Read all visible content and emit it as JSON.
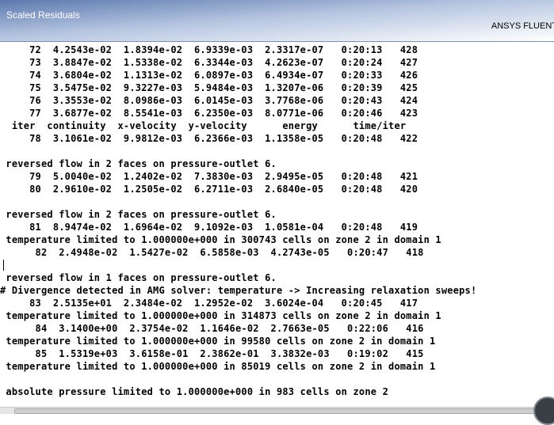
{
  "window": {
    "title": "Scaled Residuals",
    "brand": "ANSYS FLUENT"
  },
  "console": {
    "lines": [
      "     72  4.2543e-02  1.8394e-02  6.9339e-03  2.3317e-07   0:20:13   428",
      "     73  3.8847e-02  1.5338e-02  6.3344e-03  4.2623e-07   0:20:24   427",
      "     74  3.6804e-02  1.1313e-02  6.0897e-03  6.4934e-07   0:20:33   426",
      "     75  3.5475e-02  9.3227e-03  5.9484e-03  1.3207e-06   0:20:39   425",
      "     76  3.3553e-02  8.0986e-03  6.0145e-03  3.7768e-06   0:20:43   424",
      "     77  3.6877e-02  8.5541e-03  6.2350e-03  8.0771e-06   0:20:46   423",
      "  iter  continuity  x-velocity  y-velocity      energy      time/iter",
      "     78  3.1061e-02  9.9812e-03  6.2366e-03  1.1358e-05   0:20:48   422",
      "",
      " reversed flow in 2 faces on pressure-outlet 6.",
      "     79  5.0040e-02  1.2402e-02  7.3830e-03  2.9495e-05   0:20:48   421",
      "     80  2.9610e-02  1.2505e-02  6.2711e-03  2.6840e-05   0:20:48   420",
      "",
      " reversed flow in 2 faces on pressure-outlet 6.",
      "     81  8.9474e-02  1.6964e-02  9.1092e-03  1.0581e-04   0:20:48   419",
      " temperature limited to 1.000000e+000 in 300743 cells on zone 2 in domain 1",
      "      82  2.4948e-02  1.5427e-02  6.5858e-03  4.2743e-05   0:20:47   418",
      "",
      " reversed flow in 1 faces on pressure-outlet 6.",
      "# Divergence detected in AMG solver: temperature -> Increasing relaxation sweeps!",
      "     83  2.5135e+01  2.3484e-02  1.2952e-02  3.6024e-04   0:20:45   417",
      " temperature limited to 1.000000e+000 in 314873 cells on zone 2 in domain 1",
      "      84  3.1400e+00  2.3754e-02  1.1646e-02  2.7663e-05   0:22:06   416",
      " temperature limited to 1.000000e+000 in 99580 cells on zone 2 in domain 1",
      "      85  1.5319e+03  3.6158e-01  2.3862e-01  3.3832e-03   0:19:02   415",
      " temperature limited to 1.000000e+000 in 85019 cells on zone 2 in domain 1",
      "",
      " absolute pressure limited to 1.000000e+000 in 983 cells on zone 2"
    ]
  }
}
